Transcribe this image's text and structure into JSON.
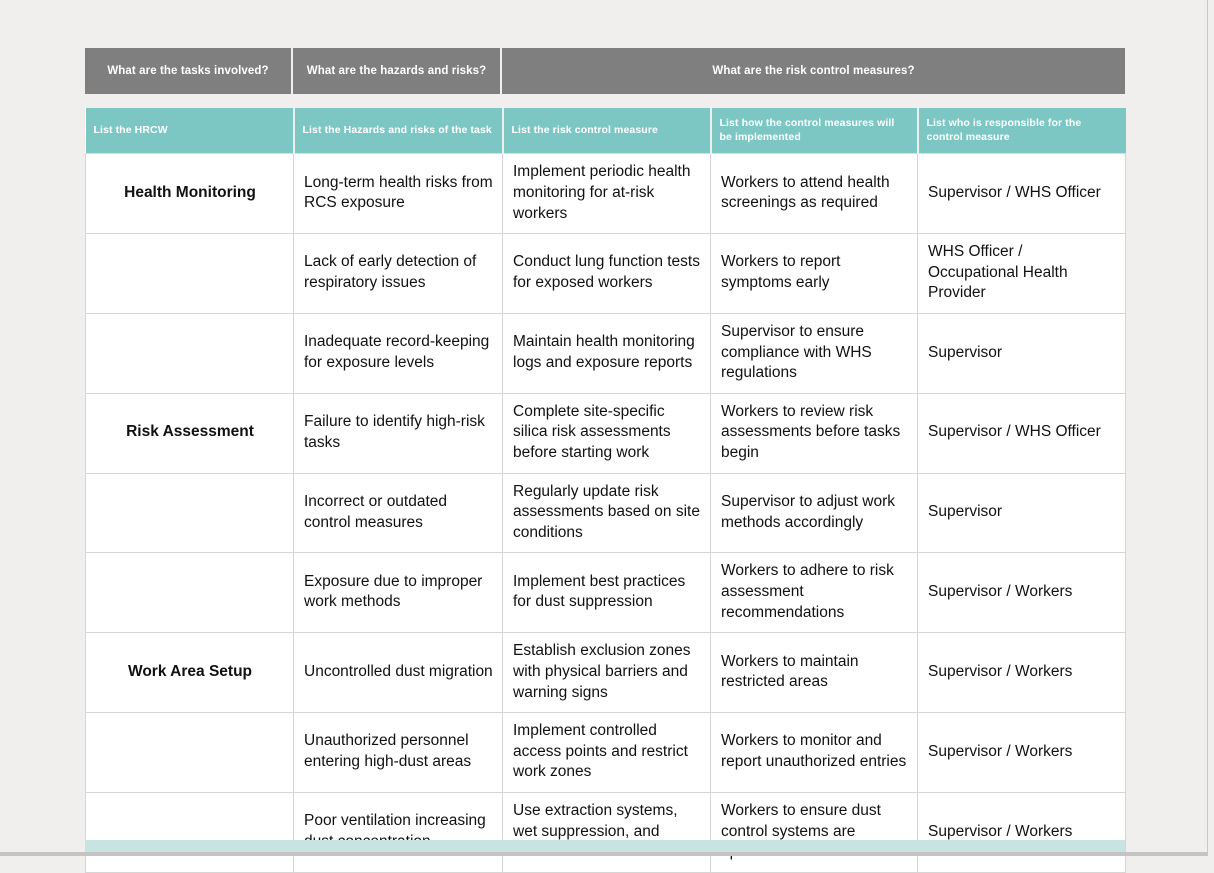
{
  "colors": {
    "group_header_bg": "#7f7f7f",
    "column_header_bg": "#7cc7c4",
    "page_bg": "#f0efee",
    "bottom_strip_bg": "#c7e4e2",
    "cell_border": "#d6d6d6"
  },
  "group_headers": [
    {
      "label": "What are the tasks involved?"
    },
    {
      "label": "What are the hazards and risks?"
    },
    {
      "label": "What are the risk control measures?"
    }
  ],
  "column_headers": [
    {
      "label": "List the HRCW"
    },
    {
      "label": "List the Hazards and risks of the task"
    },
    {
      "label": "List the risk control measure"
    },
    {
      "label": "List how the control measures will be implemented"
    },
    {
      "label": "List who is responsible for the control measure"
    }
  ],
  "rows": [
    {
      "task": "Health Monitoring",
      "hazard": "Long-term health risks from RCS exposure",
      "control": "Implement periodic health monitoring for at-risk workers",
      "implementation": "Workers to attend health screenings as required",
      "responsible": "Supervisor / WHS Officer"
    },
    {
      "task": "",
      "hazard": "Lack of early detection of respiratory issues",
      "control": "Conduct lung function tests for exposed workers",
      "implementation": "Workers to report symptoms early",
      "responsible": "WHS Officer / Occupational Health Provider"
    },
    {
      "task": "",
      "hazard": "Inadequate record-keeping for exposure levels",
      "control": "Maintain health monitoring logs and exposure reports",
      "implementation": "Supervisor to ensure compliance with WHS regulations",
      "responsible": "Supervisor"
    },
    {
      "task": "Risk Assessment",
      "hazard": "Failure to identify high-risk tasks",
      "control": "Complete site-specific silica risk assessments before starting work",
      "implementation": "Workers to review risk assessments before tasks begin",
      "responsible": "Supervisor / WHS Officer"
    },
    {
      "task": "",
      "hazard": "Incorrect or outdated control measures",
      "control": "Regularly update risk assessments based on site conditions",
      "implementation": "Supervisor to adjust work methods accordingly",
      "responsible": "Supervisor"
    },
    {
      "task": "",
      "hazard": "Exposure due to improper work methods",
      "control": "Implement best practices for dust suppression",
      "implementation": "Workers to adhere to risk assessment recommendations",
      "responsible": "Supervisor / Workers"
    },
    {
      "task": "Work Area Setup",
      "hazard": "Uncontrolled dust migration",
      "control": "Establish exclusion zones with physical barriers and warning signs",
      "implementation": "Workers to maintain restricted areas",
      "responsible": "Supervisor / Workers"
    },
    {
      "task": "",
      "hazard": "Unauthorized personnel entering high-dust areas",
      "control": "Implement controlled access points and restrict work zones",
      "implementation": "Workers to monitor and report unauthorized entries",
      "responsible": "Supervisor / Workers"
    },
    {
      "task": "",
      "hazard": "Poor ventilation increasing dust concentration",
      "control": "Use extraction systems, wet suppression, and natural ventilation",
      "implementation": "Workers to ensure dust control systems are operational",
      "responsible": "Supervisor / Workers"
    }
  ]
}
